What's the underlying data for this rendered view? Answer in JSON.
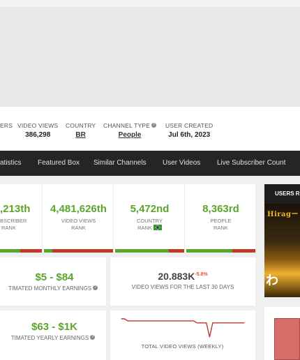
{
  "info_bar": {
    "subscribers_label_partial": "ERS",
    "video_views": {
      "label": "VIDEO VIEWS",
      "value": "386,298"
    },
    "country": {
      "label": "COUNTRY",
      "value": "BR"
    },
    "channel_type": {
      "label": "CHANNEL TYPE",
      "value": "People"
    },
    "user_created": {
      "label": "USER CREATED",
      "value": "Jul 6th, 2023"
    }
  },
  "nav": {
    "items": [
      "atistics",
      "Featured Box",
      "Similar Channels",
      "User Videos",
      "Live Subscriber Count"
    ]
  },
  "ranks": [
    {
      "value": ",213th",
      "label_line1": "BSCRIBER",
      "label_line2": "RANK",
      "fill": 0.49
    },
    {
      "value": "4,481,626th",
      "label_line1": "VIDEO VIEWS",
      "label_line2": "RANK",
      "fill": 0.12
    },
    {
      "value": "5,472nd",
      "label_line1": "COUNTRY",
      "label_line2": "RANK",
      "fill": 0.78
    },
    {
      "value": "8,363rd",
      "label_line1": "PEOPLE",
      "label_line2": "RANK",
      "fill": 0.67
    }
  ],
  "earnings": {
    "monthly": {
      "value": "$5  -  $84",
      "label": "TIMATED MONTHLY EARNINGS"
    },
    "yearly": {
      "value": "$63  -  $1K",
      "label": "TIMATED YEARLY EARNINGS"
    }
  },
  "views_30": {
    "value": "20.883K",
    "delta": "-5.8%",
    "label": "VIDEO VIEWS FOR THE LAST 30 DAYS"
  },
  "weekly_chart": {
    "caption": "TOTAL VIDEO VIEWS (WEEKLY)"
  },
  "chart_data": {
    "type": "line",
    "title": "TOTAL VIDEO VIEWS (WEEKLY)",
    "series": [
      {
        "values": [
          386,
          386,
          385,
          385,
          385,
          385,
          385,
          385,
          385,
          385,
          385,
          385,
          385,
          385,
          385,
          385,
          385,
          385,
          385,
          385,
          385,
          385,
          385,
          385,
          384,
          384,
          384,
          384,
          377,
          384,
          384,
          384,
          384,
          384,
          384,
          384,
          384,
          384,
          384,
          384
        ]
      }
    ],
    "grid": false,
    "legend": "none"
  },
  "side_ad": {
    "header": "USERS RE",
    "title": "Hiragー",
    "kanji": "わ"
  },
  "colors": {
    "rank_green": "#5aa62c",
    "bar_red": "#c0392b",
    "nav_bg": "#252525",
    "line_red": "#c0392b"
  }
}
